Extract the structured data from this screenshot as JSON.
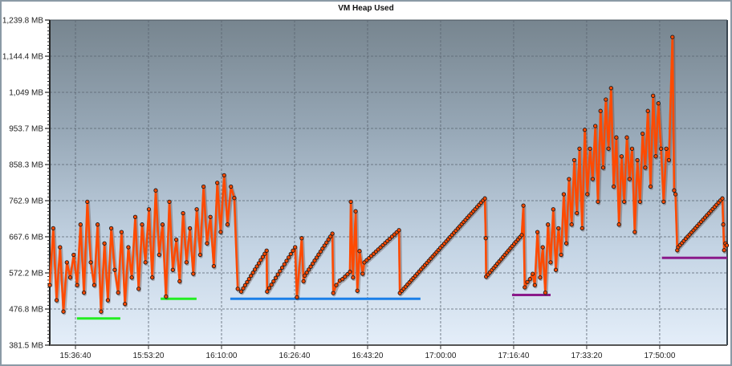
{
  "chart_data": {
    "type": "line",
    "title": "VM Heap Used",
    "xlabel": "",
    "ylabel": "",
    "x_unit": "minutes since 15:30:00",
    "xlim": [
      0.8,
      155.4
    ],
    "ylim": [
      381.5,
      1239.8
    ],
    "grid": true,
    "y_ticks": [
      {
        "value": 381.5,
        "label": "381.5 MB"
      },
      {
        "value": 476.8,
        "label": "476.8 MB"
      },
      {
        "value": 572.2,
        "label": "572.2 MB"
      },
      {
        "value": 667.6,
        "label": "667.6 MB"
      },
      {
        "value": 762.9,
        "label": "762.9 MB"
      },
      {
        "value": 858.3,
        "label": "858.3 MB"
      },
      {
        "value": 953.7,
        "label": "953.7 MB"
      },
      {
        "value": 1049,
        "label": "1,049 MB"
      },
      {
        "value": 1144.4,
        "label": "1,144.4 MB"
      },
      {
        "value": 1239.8,
        "label": "1,239.8 MB"
      }
    ],
    "x_ticks": [
      {
        "value": 6.667,
        "label": "15:36:40"
      },
      {
        "value": 23.333,
        "label": "15:53:20"
      },
      {
        "value": 40,
        "label": "16:10:00"
      },
      {
        "value": 56.667,
        "label": "16:26:40"
      },
      {
        "value": 73.333,
        "label": "16:43:20"
      },
      {
        "value": 90,
        "label": "17:00:00"
      },
      {
        "value": 106.667,
        "label": "17:16:40"
      },
      {
        "value": 123.333,
        "label": "17:33:20"
      },
      {
        "value": 140,
        "label": "17:50:00"
      }
    ],
    "series": {
      "name": "VM Heap Used",
      "color": "#ff4a00",
      "segments": [
        {
          "kind": "samples",
          "t0": 0.8,
          "dt": 0.78,
          "values": [
            540,
            690,
            500,
            640,
            470,
            600,
            560,
            620,
            540,
            700,
            520,
            760,
            600,
            540,
            700,
            470,
            650,
            500,
            690,
            580,
            520,
            680,
            490,
            640,
            560,
            720,
            530,
            700,
            600,
            740,
            560,
            790,
            620,
            700,
            510,
            760,
            580,
            660,
            550,
            730,
            600,
            690,
            570,
            740,
            620,
            800,
            650,
            720,
            590,
            810,
            680,
            830,
            700,
            800,
            770,
            530
          ]
        },
        {
          "kind": "ramp",
          "t0": 44.5,
          "v0": 523,
          "t1": 50.3,
          "v1": 631,
          "n": 14
        },
        {
          "kind": "ramp",
          "t0": 50.4,
          "v0": 523,
          "t1": 56.8,
          "v1": 640,
          "n": 14
        },
        {
          "kind": "points",
          "points": [
            [
              57.2,
              508
            ],
            [
              58.3,
              664
            ],
            [
              58.7,
              550
            ]
          ]
        },
        {
          "kind": "ramp",
          "t0": 59.0,
          "v0": 565,
          "t1": 65.3,
          "v1": 676,
          "n": 15
        },
        {
          "kind": "points",
          "points": [
            [
              65.5,
              519
            ],
            [
              66.2,
              540
            ],
            [
              67.0,
              552
            ]
          ]
        },
        {
          "kind": "ramp",
          "t0": 67.6,
          "v0": 556,
          "t1": 69.3,
          "v1": 575,
          "n": 4
        },
        {
          "kind": "points",
          "points": [
            [
              69.5,
              760
            ],
            [
              70.0,
              560
            ],
            [
              70.6,
              735
            ],
            [
              71.0,
              525
            ],
            [
              71.5,
              630
            ],
            [
              72.2,
              570
            ]
          ]
        },
        {
          "kind": "ramp",
          "t0": 72.6,
          "v0": 600,
          "t1": 80.5,
          "v1": 685,
          "n": 16
        },
        {
          "kind": "ramp",
          "t0": 80.7,
          "v0": 519,
          "t1": 100.1,
          "v1": 769,
          "n": 45
        },
        {
          "kind": "points",
          "points": [
            [
              100.3,
              664
            ]
          ]
        },
        {
          "kind": "ramp",
          "t0": 100.4,
          "v0": 562,
          "t1": 108.5,
          "v1": 672,
          "n": 20
        },
        {
          "kind": "points",
          "points": [
            [
              108.9,
              750
            ],
            [
              109.2,
              534
            ],
            [
              109.8,
              548
            ],
            [
              110.4,
              556
            ],
            [
              111.0,
              570
            ]
          ]
        },
        {
          "kind": "samples",
          "t0": 111.5,
          "dt": 0.6,
          "values": [
            540,
            680,
            560,
            640,
            520,
            700,
            600,
            740,
            580,
            690,
            620,
            780,
            650,
            820,
            700,
            870,
            730,
            900,
            690,
            950,
            780,
            900,
            820,
            960,
            760,
            1000,
            850,
            1030,
            900,
            1060,
            800,
            930,
            700,
            880,
            760,
            930,
            820,
            900,
            680,
            870,
            760,
            940,
            850,
            1000,
            800,
            1040,
            880,
            1020,
            900,
            760,
            900,
            870
          ]
        },
        {
          "kind": "points",
          "points": [
            [
              142.9,
              1195
            ],
            [
              143.3,
              790
            ],
            [
              143.6,
              780
            ],
            [
              144.0,
              632
            ]
          ]
        },
        {
          "kind": "ramp",
          "t0": 144.2,
          "v0": 640,
          "t1": 154.3,
          "v1": 769,
          "n": 24
        },
        {
          "kind": "points",
          "points": [
            [
              154.5,
              700
            ],
            [
              154.7,
              632
            ],
            [
              155.0,
              650
            ],
            [
              155.3,
              645
            ]
          ]
        }
      ]
    },
    "reference_lines": [
      {
        "value": 452,
        "t_start": 7.0,
        "t_end": 16.9,
        "color": "#22ee22"
      },
      {
        "value": 504,
        "t_start": 26.1,
        "t_end": 34.3,
        "color": "#22ee22"
      },
      {
        "value": 504,
        "t_start": 42.0,
        "t_end": 85.4,
        "color": "#1a7fe8"
      },
      {
        "value": 514,
        "t_start": 106.3,
        "t_end": 115.1,
        "color": "#8a1a8a"
      },
      {
        "value": 612,
        "t_start": 140.5,
        "t_end": 155.4,
        "color": "#8a1a8a"
      }
    ]
  }
}
